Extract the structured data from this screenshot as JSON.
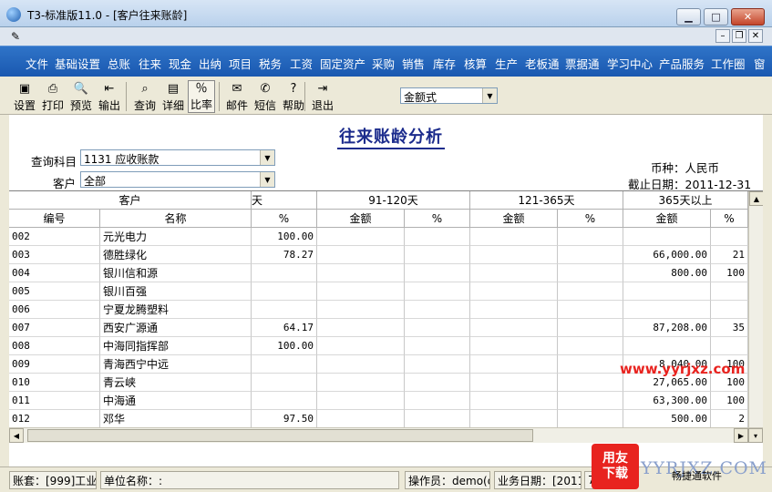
{
  "window": {
    "title": "T3-标准版11.0 - [客户往来账龄]"
  },
  "menu": [
    "文件",
    "基础设置",
    "总账",
    "往来",
    "现金",
    "出纳",
    "项目",
    "税务",
    "工资",
    "固定资产",
    "采购",
    "销售",
    "库存",
    "核算",
    "生产",
    "老板通",
    "票据通",
    "学习中心",
    "产品服务",
    "工作圈",
    "窗"
  ],
  "toolbar": {
    "buttons": [
      {
        "label": "设置",
        "icon": "settings-icon"
      },
      {
        "label": "打印",
        "icon": "printer-icon"
      },
      {
        "label": "预览",
        "icon": "preview-icon"
      },
      {
        "label": "输出",
        "icon": "export-icon"
      },
      {
        "label": "查询",
        "icon": "binoculars-icon"
      },
      {
        "label": "详细",
        "icon": "detail-icon"
      },
      {
        "label": "比率",
        "icon": "percent-icon"
      },
      {
        "label": "邮件",
        "icon": "mail-icon"
      },
      {
        "label": "短信",
        "icon": "sms-icon"
      },
      {
        "label": "帮助",
        "icon": "help-icon"
      },
      {
        "label": "退出",
        "icon": "exit-icon"
      }
    ],
    "mode_select": "金额式"
  },
  "report": {
    "title": "往来账龄分析",
    "subject_label": "查询科目",
    "subject_value": "1131 应收账款",
    "customer_label": "客户",
    "customer_value": "全部",
    "currency_label": "币种：人民币",
    "cutoff_label": "截止日期：2011-12-31"
  },
  "grid": {
    "group_headers": [
      "客户",
      "天",
      "91-120天",
      "121-365天",
      "365天以上"
    ],
    "sub_headers": [
      "编号",
      "名称",
      "%",
      "金额",
      "%",
      "金额",
      "%",
      "金额",
      "%"
    ],
    "rows": [
      {
        "code": "002",
        "name": "元光电力",
        "pct1": "100.00",
        "amt2": "",
        "pct2": "",
        "amt3": "",
        "pct3": "",
        "amt4": "",
        "pct4": ""
      },
      {
        "code": "003",
        "name": "德胜绿化",
        "pct1": "78.27",
        "amt2": "",
        "pct2": "",
        "amt3": "",
        "pct3": "",
        "amt4": "66,000.00",
        "pct4": "21"
      },
      {
        "code": "004",
        "name": "银川信和源",
        "pct1": "",
        "amt2": "",
        "pct2": "",
        "amt3": "",
        "pct3": "",
        "amt4": "800.00",
        "pct4": "100"
      },
      {
        "code": "005",
        "name": "银川百强",
        "pct1": "",
        "amt2": "",
        "pct2": "",
        "amt3": "",
        "pct3": "",
        "amt4": "",
        "pct4": ""
      },
      {
        "code": "006",
        "name": "宁夏龙腾塑料",
        "pct1": "",
        "amt2": "",
        "pct2": "",
        "amt3": "",
        "pct3": "",
        "amt4": "",
        "pct4": ""
      },
      {
        "code": "007",
        "name": "西安广源通",
        "pct1": "64.17",
        "amt2": "",
        "pct2": "",
        "amt3": "",
        "pct3": "",
        "amt4": "87,208.00",
        "pct4": "35"
      },
      {
        "code": "008",
        "name": "中海同指挥部",
        "pct1": "100.00",
        "amt2": "",
        "pct2": "",
        "amt3": "",
        "pct3": "",
        "amt4": "",
        "pct4": ""
      },
      {
        "code": "009",
        "name": "青海西宁中远",
        "pct1": "",
        "amt2": "",
        "pct2": "",
        "amt3": "",
        "pct3": "",
        "amt4": "8,040.00",
        "pct4": "100"
      },
      {
        "code": "010",
        "name": "青云峡",
        "pct1": "",
        "amt2": "",
        "pct2": "",
        "amt3": "",
        "pct3": "",
        "amt4": "27,065.00",
        "pct4": "100"
      },
      {
        "code": "011",
        "name": "中海通",
        "pct1": "",
        "amt2": "",
        "pct2": "",
        "amt3": "",
        "pct3": "",
        "amt4": "63,300.00",
        "pct4": "100"
      },
      {
        "code": "012",
        "name": "邓华",
        "pct1": "97.50",
        "amt2": "",
        "pct2": "",
        "amt3": "",
        "pct3": "",
        "amt4": "500.00",
        "pct4": "2"
      }
    ]
  },
  "status": {
    "account": "账套：[999]工业",
    "company": "单位名称：:",
    "operator": "操作员：demo(de",
    "business_date": "业务日期：[2011",
    "extra": "7-3"
  },
  "watermark": {
    "url": "www.yyrjxz.com",
    "logo_line1": "用友",
    "logo_line2": "下载",
    "site": "YYRJXZ.COM",
    "tagline": "畅捷通软件"
  }
}
